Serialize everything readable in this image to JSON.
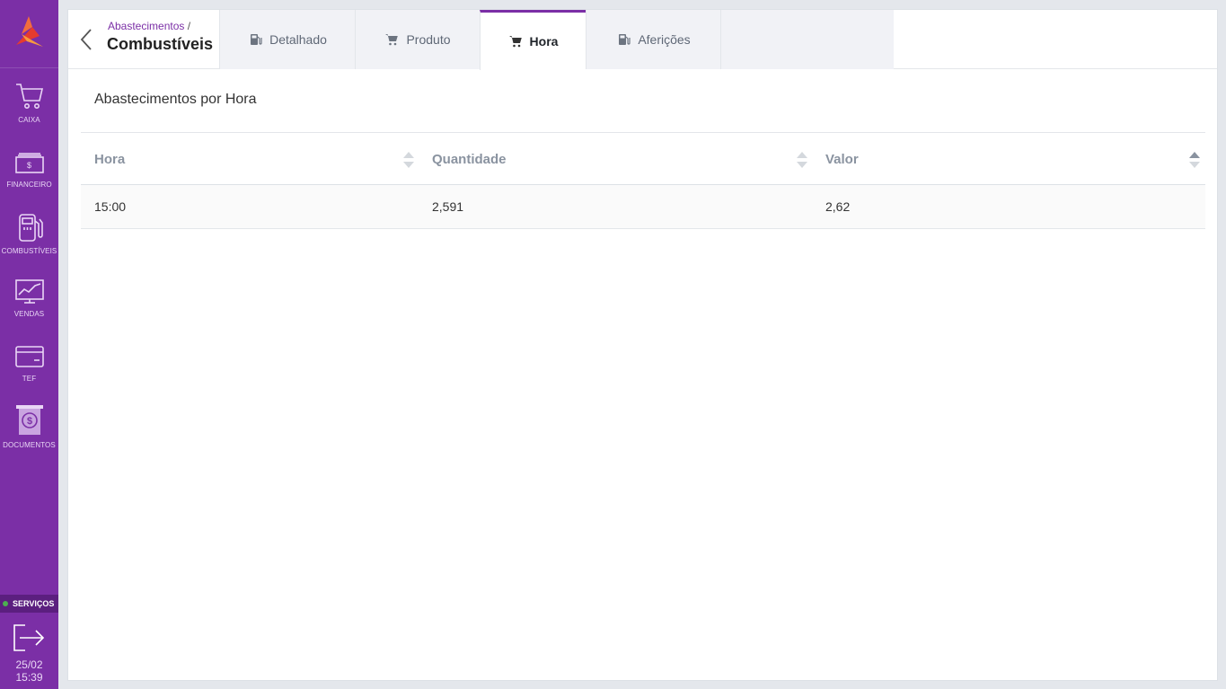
{
  "sidebar": {
    "items": [
      {
        "label": "CAIXA",
        "icon": "cart-icon"
      },
      {
        "label": "FINANCEIRO",
        "icon": "money-icon"
      },
      {
        "label": "COMBUSTÍVEIS",
        "icon": "fuel-pump-icon"
      },
      {
        "label": "VENDAS",
        "icon": "sales-chart-icon"
      },
      {
        "label": "TEF",
        "icon": "credit-card-icon"
      },
      {
        "label": "DOCUMENTOS",
        "icon": "document-icon"
      }
    ],
    "servicos_label": "SERVIÇOS",
    "date": "25/02",
    "time": "15:39"
  },
  "header": {
    "breadcrumb_parent": "Abastecimentos",
    "breadcrumb_separator": "/",
    "title": "Combustíveis",
    "tabs": [
      {
        "label": "Detalhado",
        "icon": "fuel-pump-icon",
        "active": false
      },
      {
        "label": "Produto",
        "icon": "cart-icon",
        "active": false
      },
      {
        "label": "Hora",
        "icon": "cart-icon",
        "active": true
      },
      {
        "label": "Aferições",
        "icon": "fuel-pump-icon",
        "active": false
      }
    ]
  },
  "main": {
    "section_title": "Abastecimentos por Hora",
    "table": {
      "columns": [
        "Hora",
        "Quantidade",
        "Valor"
      ],
      "rows": [
        [
          "15:00",
          "2,591",
          "2,62"
        ]
      ]
    }
  },
  "colors": {
    "brand": "#7b2fa6",
    "status_online": "#4caf50"
  }
}
